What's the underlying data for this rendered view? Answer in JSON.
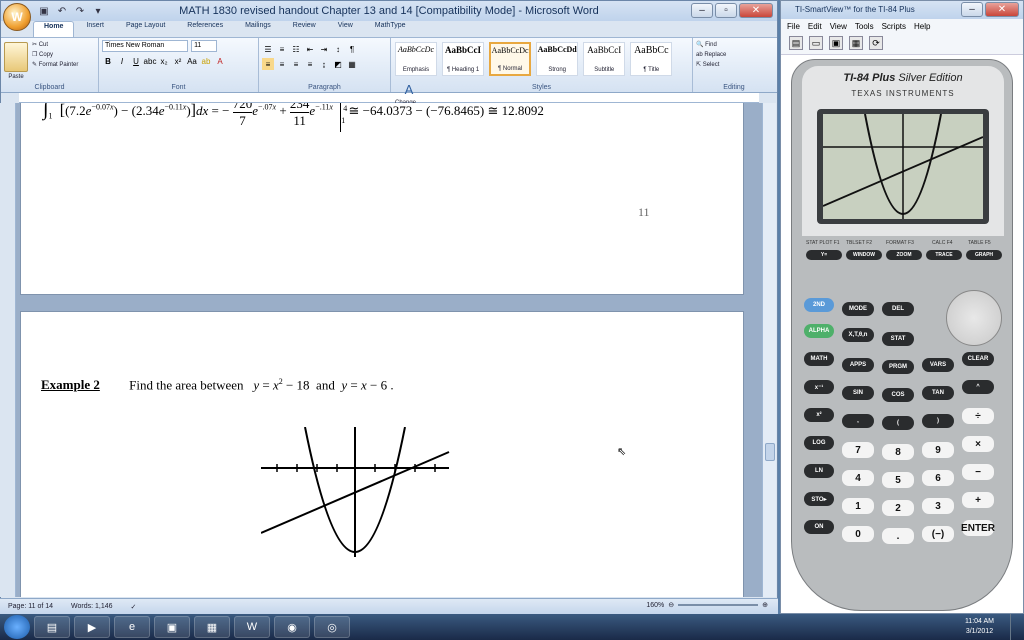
{
  "word": {
    "title": "MATH 1830 revised handout Chapter 13 and 14 [Compatibility Mode] - Microsoft Word",
    "tabs": [
      "Home",
      "Insert",
      "Page Layout",
      "References",
      "Mailings",
      "Review",
      "View",
      "MathType"
    ],
    "active_tab": "Home",
    "clipboard": {
      "paste": "Paste",
      "cut": "Cut",
      "copy": "Copy",
      "format_painter": "Format Painter",
      "label": "Clipboard"
    },
    "font": {
      "name": "Times New Roman",
      "size": "11",
      "label": "Font"
    },
    "paragraph_label": "Paragraph",
    "styles": [
      {
        "preview": "AaBbCcDc",
        "name": "Emphasis"
      },
      {
        "preview": "AaBbCcI",
        "name": "¶ Heading 1"
      },
      {
        "preview": "AaBbCcDc",
        "name": "¶ Normal",
        "selected": true
      },
      {
        "preview": "AaBbCcDd",
        "name": "Strong"
      },
      {
        "preview": "AaBbCcI",
        "name": "Subtitle"
      },
      {
        "preview": "AaBbCc",
        "name": "¶ Title"
      }
    ],
    "styles_label": "Styles",
    "change_styles": "Change Styles",
    "editing": {
      "find": "Find",
      "replace": "Replace",
      "select": "Select",
      "label": "Editing"
    },
    "document": {
      "page_number": "11",
      "example_label": "Example 2",
      "example_text": "Find the area between",
      "eq_result": "≅ −64.0373 − (−76.8465) ≅ 12.8092"
    },
    "status": {
      "page": "Page: 11 of 14",
      "words": "Words: 1,146",
      "zoom": "160%"
    }
  },
  "smartview": {
    "title": "TI-SmartView™ for the TI-84 Plus",
    "menu": [
      "File",
      "Edit",
      "View",
      "Tools",
      "Scripts",
      "Help"
    ],
    "brand": "TI-84 Plus",
    "edition": "Silver Edition",
    "maker": "TEXAS INSTRUMENTS",
    "top_labels": [
      "STAT PLOT F1",
      "TBLSET F2",
      "FORMAT F3",
      "CALC F4",
      "TABLE F5"
    ],
    "top_keys": [
      "Y=",
      "WINDOW",
      "ZOOM",
      "TRACE",
      "GRAPH"
    ],
    "rows": [
      [
        "2ND",
        "MODE",
        "DEL"
      ],
      [
        "ALPHA",
        "X,T,θ,n",
        "STAT"
      ],
      [
        "MATH",
        "APPS",
        "PRGM",
        "VARS",
        "CLEAR"
      ],
      [
        "x⁻¹",
        "SIN",
        "COS",
        "TAN",
        "^"
      ],
      [
        "x²",
        ",",
        "(",
        ")",
        "÷"
      ],
      [
        "LOG",
        "7",
        "8",
        "9",
        "×"
      ],
      [
        "LN",
        "4",
        "5",
        "6",
        "−"
      ],
      [
        "STO▸",
        "1",
        "2",
        "3",
        "+"
      ],
      [
        "ON",
        "0",
        ".",
        "(−)",
        "ENTER"
      ]
    ]
  },
  "taskbar": {
    "time": "11:04 AM",
    "date": "3/1/2012"
  }
}
